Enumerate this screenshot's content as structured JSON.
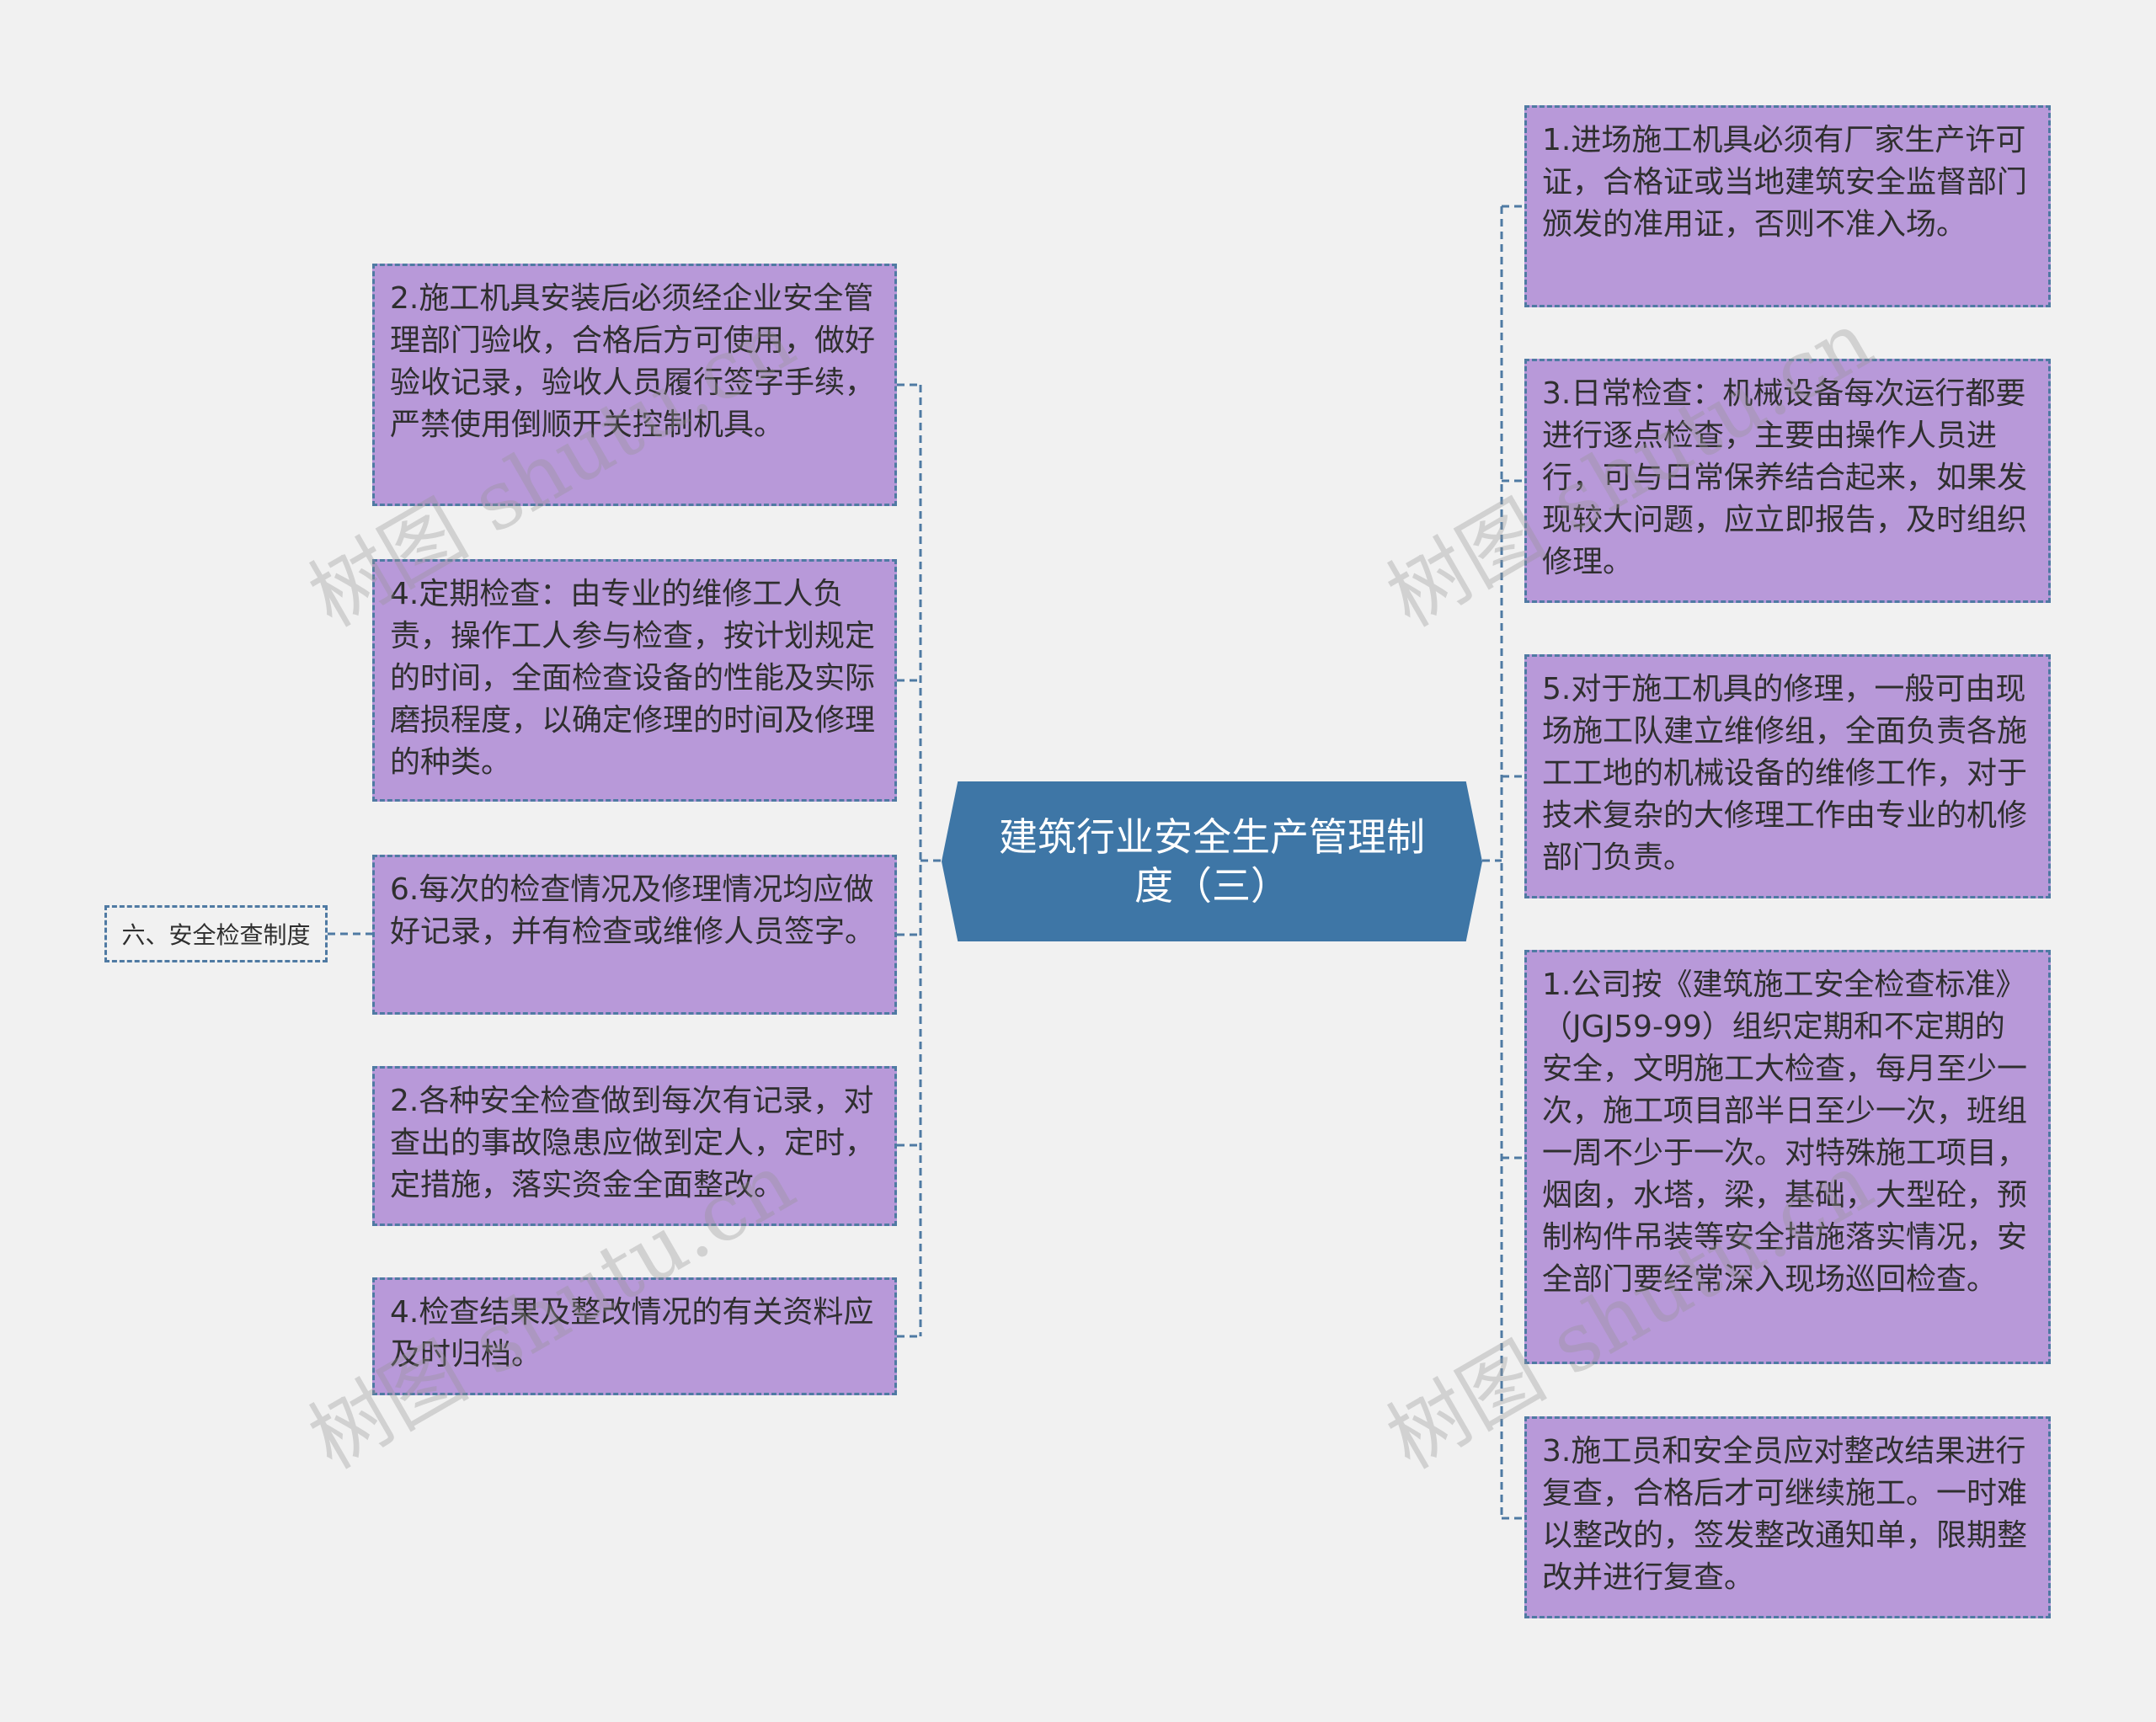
{
  "root": {
    "title": "建筑行业安全生产管理制度（三）"
  },
  "far_left": {
    "label": "六、安全检查制度"
  },
  "left_nodes": [
    {
      "text": "2.施工机具安装后必须经企业安全管理部门验收，合格后方可使用，做好验收记录，验收人员履行签字手续，严禁使用倒顺开关控制机具。"
    },
    {
      "text": "4.定期检查：由专业的维修工人负责，操作工人参与检查，按计划规定的时间，全面检查设备的性能及实际磨损程度，以确定修理的时间及修理的种类。"
    },
    {
      "text": "6.每次的检查情况及修理情况均应做好记录，并有检查或维修人员签字。"
    },
    {
      "text": "2.各种安全检查做到每次有记录，对查出的事故隐患应做到定人，定时，定措施，落实资金全面整改。"
    },
    {
      "text": "4.检查结果及整改情况的有关资料应及时归档。"
    }
  ],
  "right_nodes": [
    {
      "text": "1.进场施工机具必须有厂家生产许可证，合格证或当地建筑安全监督部门颁发的准用证，否则不准入场。"
    },
    {
      "text": "3.日常检查：机械设备每次运行都要进行逐点检查，主要由操作人员进行，可与日常保养结合起来，如果发现较大问题，应立即报告，及时组织修理。"
    },
    {
      "text": "5.对于施工机具的修理，一般可由现场施工队建立维修组，全面负责各施工工地的机械设备的维修工作，对于技术复杂的大修理工作由专业的机修部门负责。"
    },
    {
      "text": "1.公司按《建筑施工安全检查标准》（JGJ59-99）组织定期和不定期的安全，文明施工大检查，每月至少一次，施工项目部半日至少一次，班组一周不少于一次。对特殊施工项目，烟囱，水塔，梁，基础，大型砼，预制构件吊装等安全措施落实情况，安全部门要经常深入现场巡回检查。"
    },
    {
      "text": "3.施工员和安全员应对整改结果进行复查，合格后才可继续施工。一时难以整改的，签发整改通知单，限期整改并进行复查。"
    }
  ],
  "watermarks": [
    "树图 shutu.cn",
    "树图 shutu.cn",
    "树图 shutu.cn",
    "树图 shutu.cn"
  ],
  "colors": {
    "background": "#f1f1f1",
    "node_fill": "#b899d9",
    "node_border": "#4f7aa3",
    "root_fill": "#3e76a6",
    "connector": "#4f7aa3"
  }
}
